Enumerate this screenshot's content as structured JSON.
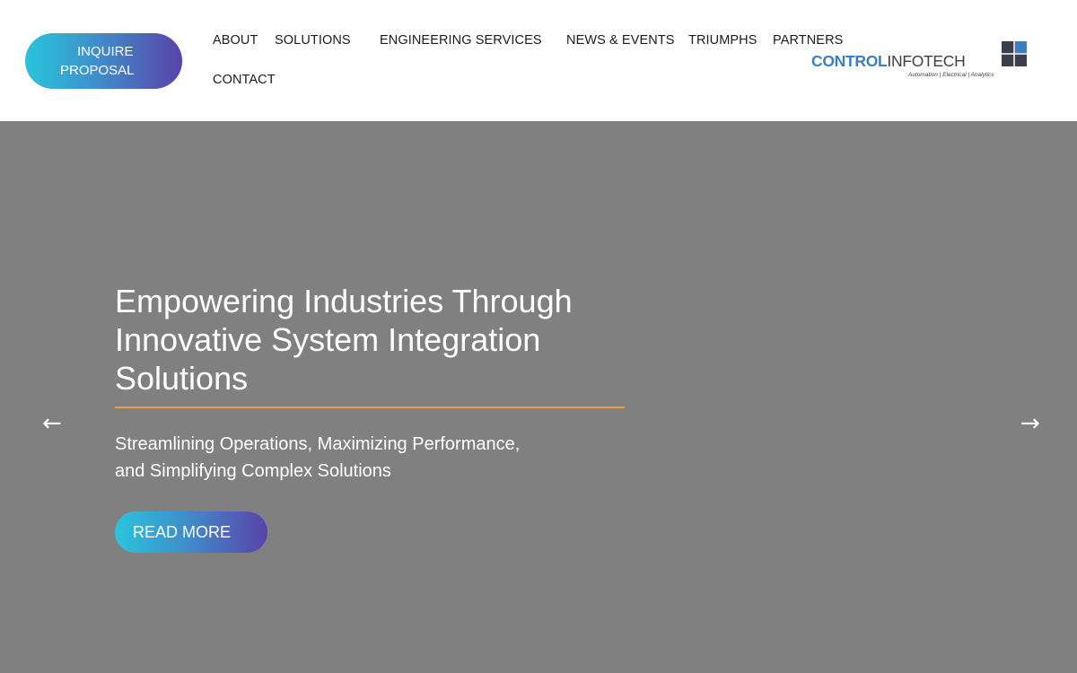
{
  "header": {
    "inquire_button": {
      "line1": "INQUIRE",
      "line2": "PROPOSAL"
    },
    "nav": {
      "about": "ABOUT",
      "solutions": "SOLUTIONS",
      "engineering_services": "ENGINEERING SERVICES",
      "news_events": "NEWS & EVENTS",
      "triumphs": "TRIUMPHS",
      "partners": "PARTNERS",
      "contact": "CONTACT"
    },
    "logo": {
      "part1": "CONTROL",
      "part2": "INFOTECH",
      "tagline": "Automation | Electrical | Analytics"
    }
  },
  "hero": {
    "title": "Empowering Industries Through Innovative System Integration Solutions",
    "subtitle_line1": "Streamlining Operations, Maximizing Performance,",
    "subtitle_line2": "and Simplifying Complex Solutions",
    "read_more": "READ MORE",
    "prev_arrow": "←",
    "next_arrow": "→"
  },
  "colors": {
    "hero_bg": "#808080",
    "accent_rule": "#e7a13d",
    "gradient_start": "#2ac4dc",
    "gradient_end": "#5a43a8",
    "logo_blue": "#3a7fc4"
  }
}
